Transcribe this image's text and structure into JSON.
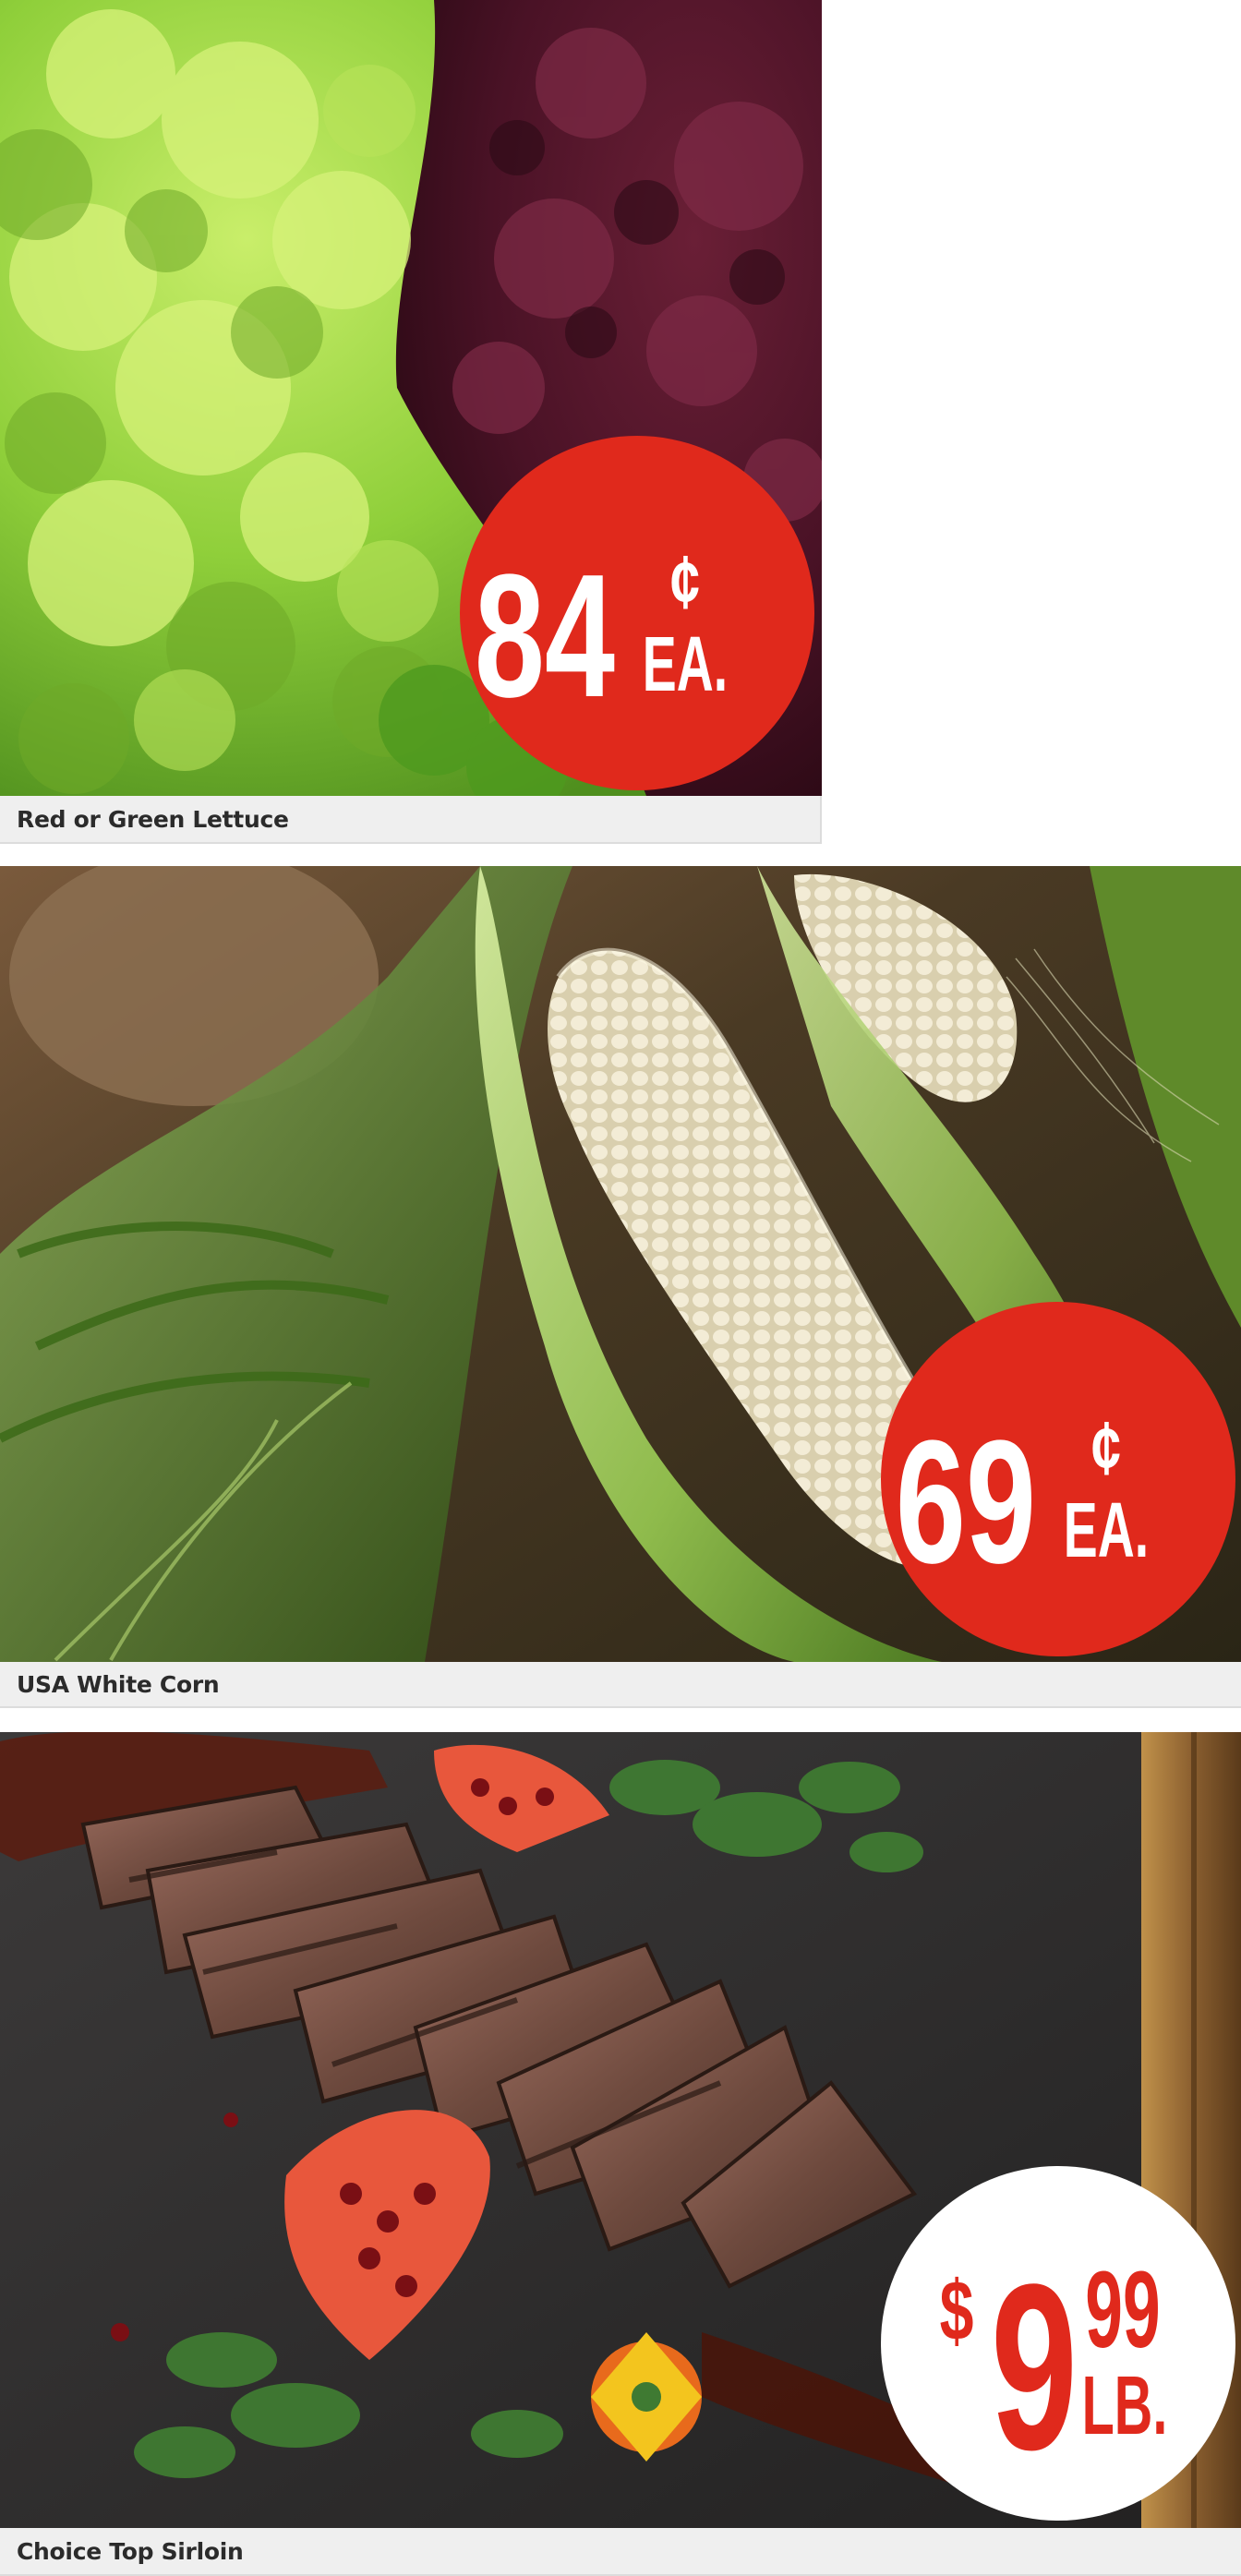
{
  "products": [
    {
      "name": "Red or Green Lettuce",
      "price_main": "84",
      "price_symbol": "¢",
      "price_unit": "EA.",
      "badge_color": "#e0291c",
      "badge_text_color": "#ffffff"
    },
    {
      "name": "USA White Corn",
      "price_main": "69",
      "price_symbol": "¢",
      "price_unit": "EA.",
      "badge_color": "#e0291c",
      "badge_text_color": "#ffffff"
    },
    {
      "name": "Choice Top Sirloin",
      "price_currency": "$",
      "price_main": "9",
      "price_cents": "99",
      "price_unit": "LB.",
      "badge_color": "#ffffff",
      "badge_text_color": "#e0291c"
    }
  ]
}
